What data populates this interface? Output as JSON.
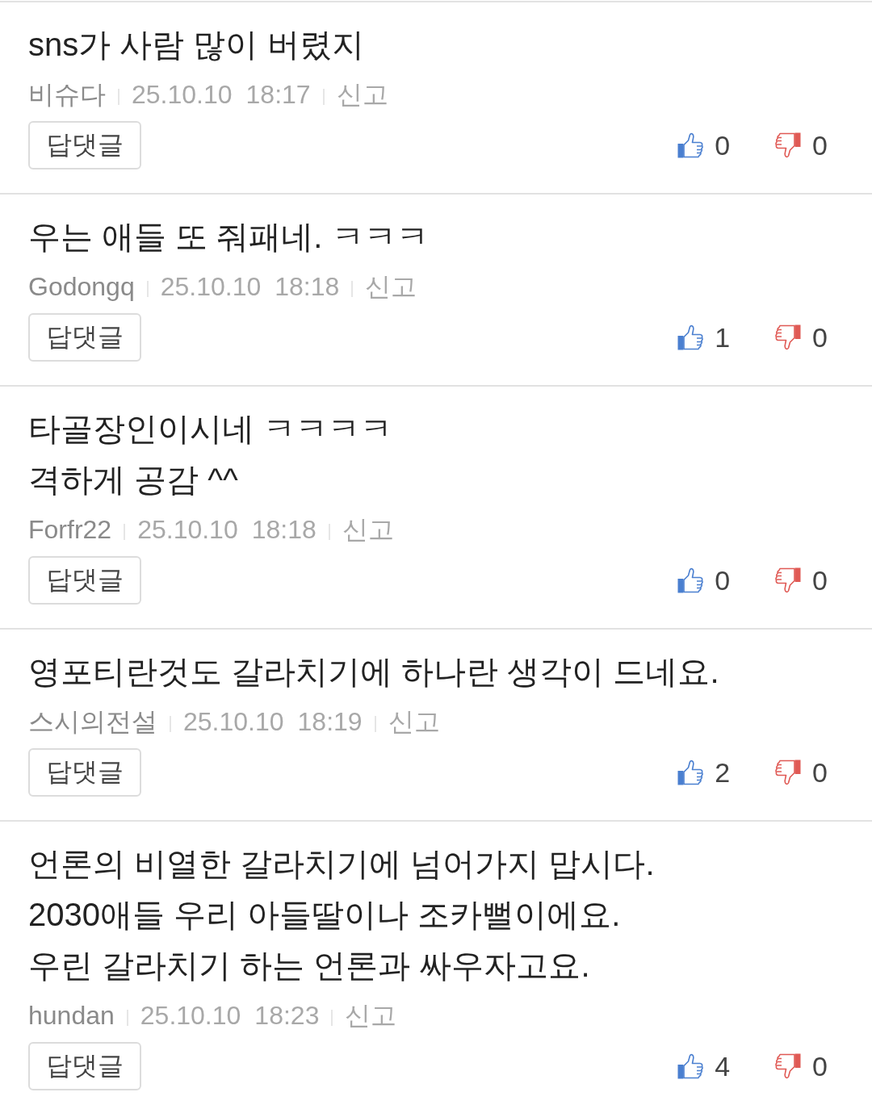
{
  "comments": [
    {
      "text": "sns가 사람 많이 버렸지",
      "author": "비슈다",
      "date": "25.10.10",
      "time": "18:17",
      "report": "신고",
      "reply_button": "답댓글",
      "likes": "0",
      "dislikes": "0"
    },
    {
      "text": "우는 애들 또 줘패네. ㅋㅋㅋ",
      "author": "Godongq",
      "date": "25.10.10",
      "time": "18:18",
      "report": "신고",
      "reply_button": "답댓글",
      "likes": "1",
      "dislikes": "0"
    },
    {
      "text": "타골장인이시네 ㅋㅋㅋㅋ\n격하게 공감 ^^",
      "author": "Forfr22",
      "date": "25.10.10",
      "time": "18:18",
      "report": "신고",
      "reply_button": "답댓글",
      "likes": "0",
      "dislikes": "0"
    },
    {
      "text": "영포티란것도 갈라치기에 하나란 생각이 드네요.",
      "author": "스시의전설",
      "date": "25.10.10",
      "time": "18:19",
      "report": "신고",
      "reply_button": "답댓글",
      "likes": "2",
      "dislikes": "0"
    },
    {
      "text": "언론의 비열한 갈라치기에 넘어가지 맙시다.\n2030애들 우리 아들딸이나 조카뻘이에요.\n우린 갈라치기 하는 언론과 싸우자고요.",
      "author": "hundan",
      "date": "25.10.10",
      "time": "18:23",
      "report": "신고",
      "reply_button": "답댓글",
      "likes": "4",
      "dislikes": "0"
    }
  ]
}
